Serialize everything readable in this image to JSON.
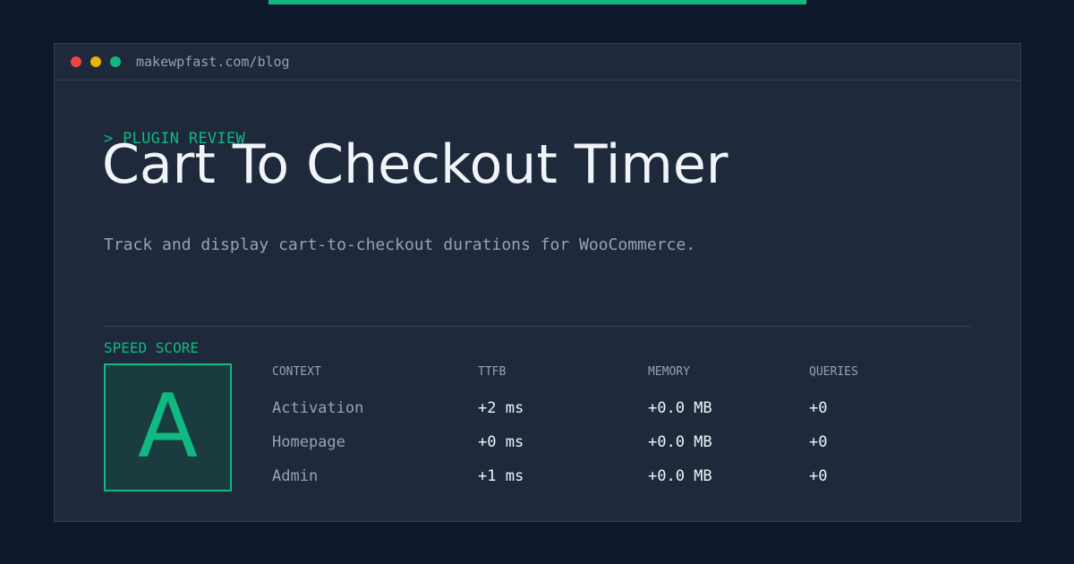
{
  "window": {
    "url": "makewpfast.com/blog"
  },
  "post": {
    "tagline": "> PLUGIN REVIEW",
    "title": "Cart To Checkout Timer",
    "subtitle": "Track and display cart-to-checkout durations for WooCommerce."
  },
  "score": {
    "label": "SPEED SCORE",
    "grade": "A"
  },
  "table": {
    "headers": [
      "CONTEXT",
      "TTFB",
      "MEMORY",
      "QUERIES"
    ],
    "rows": [
      [
        "Activation",
        "+2 ms",
        "+0.0 MB",
        "+0"
      ],
      [
        "Homepage",
        "+0 ms",
        "+0.0 MB",
        "+0"
      ],
      [
        "Admin",
        "+1 ms",
        "+0.0 MB",
        "+0"
      ]
    ]
  },
  "colors": {
    "accent": "#10b981",
    "background": "#0f172a",
    "panel": "#1e293b"
  }
}
